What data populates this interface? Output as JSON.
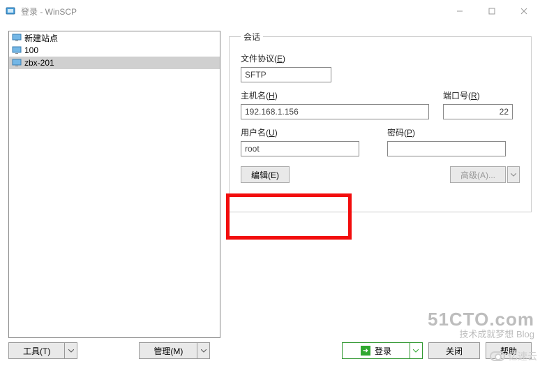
{
  "titlebar": {
    "title": "登录 - WinSCP"
  },
  "sites": {
    "items": [
      {
        "label": "新建站点",
        "selected": false
      },
      {
        "label": "100",
        "selected": false
      },
      {
        "label": "zbx-201",
        "selected": true
      }
    ]
  },
  "session": {
    "groupLabel": "会话",
    "protocolLabel": "文件协议",
    "protocolHotkey": "E",
    "protocolValue": "SFTP",
    "hostLabel": "主机名",
    "hostHotkey": "H",
    "hostValue": "192.168.1.156",
    "portLabel": "端口号",
    "portHotkey": "R",
    "portValue": "22",
    "userLabel": "用户名",
    "userHotkey": "U",
    "userValue": "root",
    "passLabel": "密码",
    "passHotkey": "P",
    "passValue": "",
    "editLabel": "编辑(E)",
    "advancedLabel": "高级(A)..."
  },
  "bottom": {
    "tools": "工具(T)",
    "manage": "管理(M)",
    "login": "登录",
    "close": "关闭",
    "help": "帮助"
  },
  "watermark": {
    "line1": "51CTO.com",
    "line2": "技术成就梦想 Blog",
    "alt": "亿速云"
  }
}
